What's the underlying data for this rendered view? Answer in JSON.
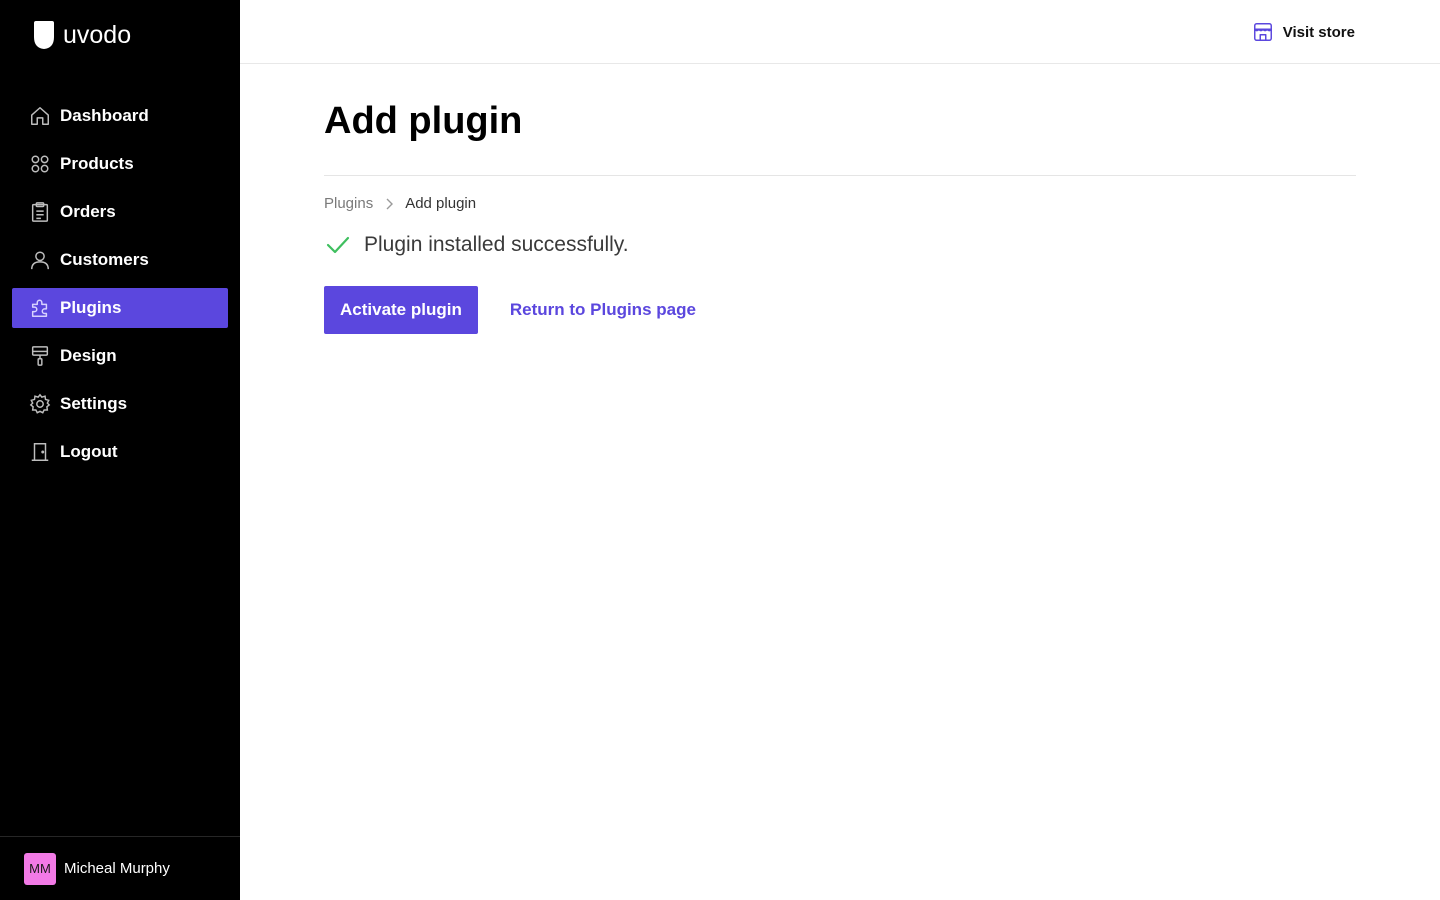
{
  "app": {
    "logo_text": "uvodo"
  },
  "sidebar": {
    "items": [
      {
        "label": "Dashboard",
        "icon": "home-icon",
        "active": false
      },
      {
        "label": "Products",
        "icon": "grid-icon",
        "active": false
      },
      {
        "label": "Orders",
        "icon": "clipboard-icon",
        "active": false
      },
      {
        "label": "Customers",
        "icon": "user-icon",
        "active": false
      },
      {
        "label": "Plugins",
        "icon": "puzzle-icon",
        "active": true
      },
      {
        "label": "Design",
        "icon": "paint-roller-icon",
        "active": false
      },
      {
        "label": "Settings",
        "icon": "gear-icon",
        "active": false
      },
      {
        "label": "Logout",
        "icon": "door-icon",
        "active": false
      }
    ]
  },
  "user": {
    "initials": "MM",
    "name": "Micheal Murphy",
    "avatar_color": "#f27ae6"
  },
  "topbar": {
    "visit_store_label": "Visit store"
  },
  "page": {
    "title": "Add plugin",
    "breadcrumb": {
      "parent": "Plugins",
      "current": "Add plugin"
    },
    "status_message": "Plugin installed successfully.",
    "primary_action": "Activate plugin",
    "secondary_action": "Return to Plugins page"
  },
  "colors": {
    "accent": "#5b47de",
    "success": "#3fbf5f",
    "sidebar_bg": "#000000"
  }
}
